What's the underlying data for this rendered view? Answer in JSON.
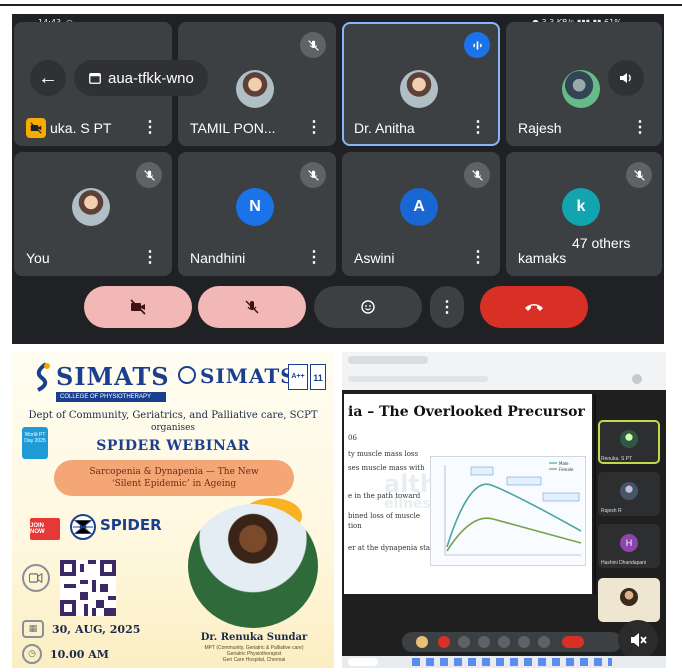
{
  "meet": {
    "status_time": "14:43",
    "status_right": "3.3 KB/s",
    "meeting_code": "aua-tfkk-wno",
    "others_label": "47 others",
    "participants": [
      {
        "name": "uka. S PT",
        "avatar": "camera-off"
      },
      {
        "name": "TAMIL PON...",
        "avatar": "photo"
      },
      {
        "name": "Dr. Anitha",
        "avatar": "photo",
        "speaking": true
      },
      {
        "name": "Rajesh",
        "avatar": "photo"
      },
      {
        "name": "You",
        "avatar": "photo"
      },
      {
        "name": "Nandhini",
        "avatar": "letter",
        "letter": "N",
        "color": "#1a73e8"
      },
      {
        "name": "Aswini",
        "avatar": "letter",
        "letter": "A",
        "color": "#1967d2"
      },
      {
        "name": "kamaks",
        "avatar": "letter",
        "letter": "k",
        "color": "#12a4af"
      }
    ],
    "colors": {
      "background": "#202124",
      "tile": "#3c4043",
      "end_call": "#d93025",
      "muted_control": "#f2b8b5"
    }
  },
  "poster": {
    "brand_left": "SIMATS",
    "brand_left_sub": "COLLEGE OF PHYSIOTHERAPY",
    "brand_right": "SIMATS",
    "naac_grade": "A++",
    "rank_badge": "11",
    "department": "Dept of Community, Geriatrics, and Palliative care, SCPT",
    "organises": "organises",
    "event_type": "SPIDER WEBINAR",
    "pt_day_badge": "World PT Day 2025",
    "topic_line1": "Sarcopenia & Dynapenia — The New",
    "topic_line2": "‘Silent Epidemic’ in Ageing",
    "join_label": "JOIN NOW",
    "spider_label": "SPIDER",
    "speaker_name": "Dr. Renuka Sundar",
    "speaker_role_1": "MPT (Community, Geriatric & Palliative care)",
    "speaker_role_2": "Geriatric Physiotherapist",
    "speaker_role_3": "Geri Care Hospital, Chennai",
    "date": "30, AUG, 2025",
    "time": "10.00 AM"
  },
  "slide": {
    "title": "ia – The Overlooked Precursor",
    "bullets": [
      "06",
      "ty muscle mass loss",
      "ses muscle mass with",
      "e in the path toward",
      "bined loss of muscle",
      "tion",
      "er at the dynapenia stage"
    ],
    "ghost_1": "althy",
    "ghost_2": "ellness at",
    "legend_1": "Male",
    "legend_2": "Female",
    "side_tiles": [
      "Renuka. S PT",
      "Rajesh R",
      "Hashini Dhandapani"
    ]
  }
}
